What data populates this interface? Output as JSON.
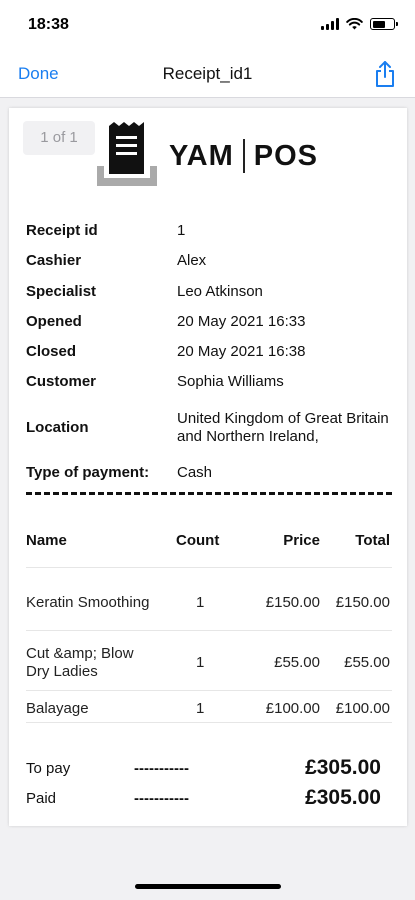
{
  "status_bar": {
    "time": "18:38"
  },
  "nav": {
    "done_label": "Done",
    "title": "Receipt_id1"
  },
  "receipt": {
    "page_indicator": "1 of 1",
    "logo": {
      "left": "YAM",
      "right": "POS"
    },
    "info": [
      {
        "label": "Receipt id",
        "value": "1"
      },
      {
        "label": "Cashier",
        "value": "Alex"
      },
      {
        "label": "Specialist",
        "value": "Leo Atkinson"
      },
      {
        "label": "Opened",
        "value": "20 May 2021 16:33"
      },
      {
        "label": "Closed",
        "value": "20 May 2021 16:38"
      },
      {
        "label": "Customer",
        "value": "Sophia Williams"
      },
      {
        "label": "Location",
        "value": "United Kingdom of Great Britain and Northern Ireland,"
      },
      {
        "label": "Type of payment:",
        "value": "Cash"
      }
    ],
    "table": {
      "headers": {
        "name": "Name",
        "count": "Count",
        "price": "Price",
        "total": "Total"
      },
      "rows": [
        {
          "name": "Keratin Smoothing",
          "count": "1",
          "price": "£150.00",
          "total": "£150.00"
        },
        {
          "name": "Cut &amp; Blow Dry Ladies",
          "count": "1",
          "price": "£55.00",
          "total": "£55.00"
        },
        {
          "name": "Balayage",
          "count": "1",
          "price": "£100.00",
          "total": "£100.00"
        }
      ]
    },
    "summary": {
      "to_pay_label": "To pay",
      "to_pay_value": "£305.00",
      "paid_label": "Paid",
      "paid_value": "£305.00",
      "dashes": "-----------"
    }
  },
  "colors": {
    "accent": "#1a7ef0",
    "background": "#f1f1f3",
    "page_indicator_text": "#9a9a9f"
  }
}
